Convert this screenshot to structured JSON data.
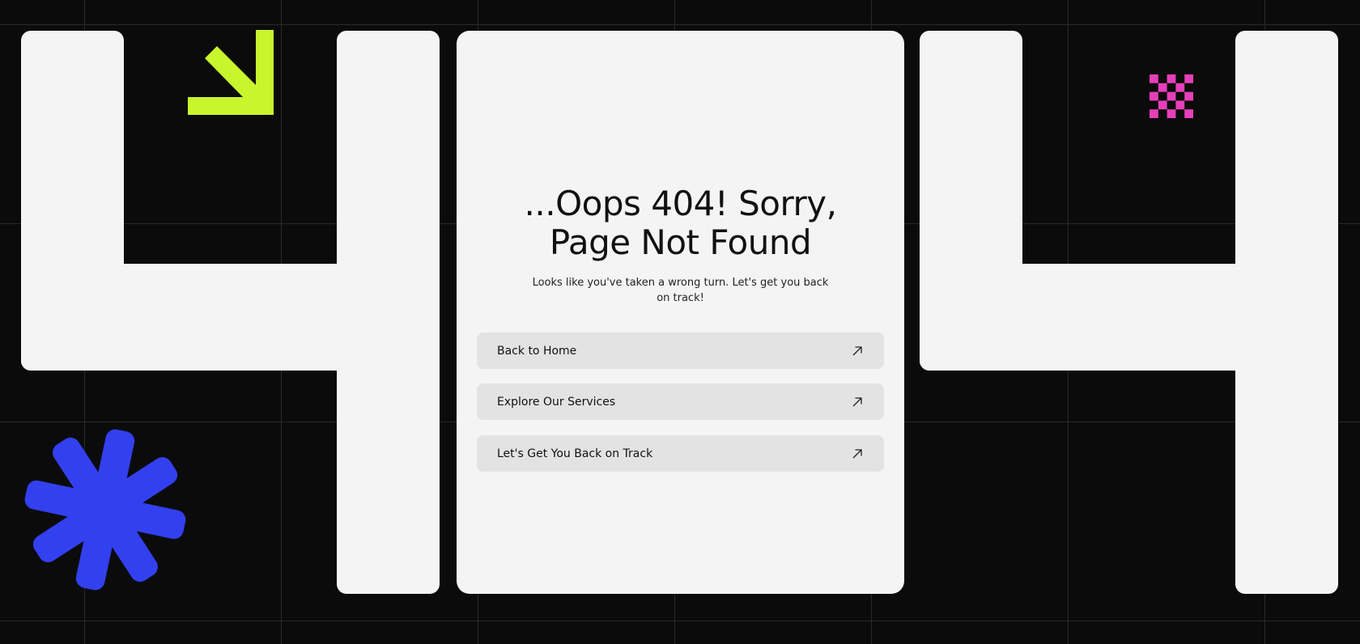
{
  "page": {
    "background_color": "#0b0b0b",
    "card_color": "#f4f4f4",
    "accent_lime": "#c8f52c",
    "accent_blue": "#3340f0",
    "accent_pink": "#e63fb9"
  },
  "card": {
    "title_line1": "...Oops 404! Sorry,",
    "title_line2": "Page Not Found",
    "subtitle": "Looks like you've taken a wrong turn. Let's get you back on track!"
  },
  "actions": [
    {
      "label": "Back to Home",
      "icon": "arrow-up-right-icon"
    },
    {
      "label": "Explore Our Services",
      "icon": "arrow-up-right-icon"
    },
    {
      "label": "Let's Get You Back on Track",
      "icon": "arrow-up-right-icon"
    }
  ],
  "decorations": {
    "arrow": "arrow-down-right-icon",
    "asterisk": "asterisk-icon",
    "checker": "checkerboard-icon"
  }
}
